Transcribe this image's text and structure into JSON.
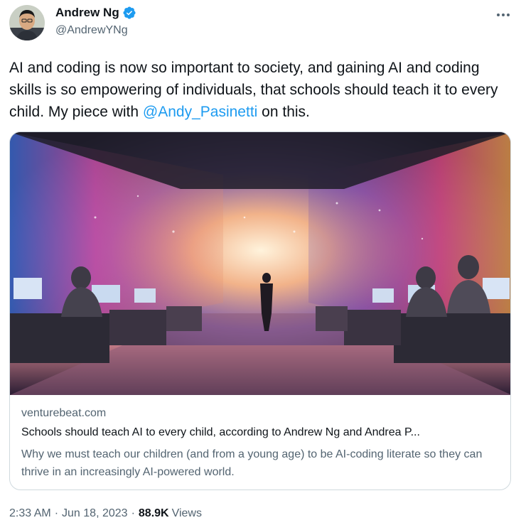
{
  "author": {
    "display_name": "Andrew Ng",
    "handle": "@AndrewYNg",
    "verified": true,
    "verified_color": "#1d9bf0"
  },
  "tweet": {
    "text_before": "AI and coding is now so important to society, and gaining AI and coding skills is so empowering of individuals, that schools should teach it to every child. My piece with ",
    "mention": "@Andy_Pasinetti",
    "text_after": " on this."
  },
  "card": {
    "domain": "venturebeat.com",
    "title": "Schools should teach AI to every child, according to Andrew Ng and Andrea P...",
    "description": "Why we must teach our children (and from a young age) to be AI-coding literate so they can thrive in an increasingly AI-powered world."
  },
  "meta": {
    "time": "2:33 AM",
    "separator": "·",
    "date": "Jun 18, 2023",
    "views_count": "88.9K",
    "views_label": "Views"
  },
  "colors": {
    "text": "#0f1419",
    "secondary": "#536471",
    "link": "#1d9bf0",
    "border": "#cfd9de"
  },
  "icons": {
    "more": "more-horizontal-icon",
    "verified": "verified-badge-icon"
  }
}
